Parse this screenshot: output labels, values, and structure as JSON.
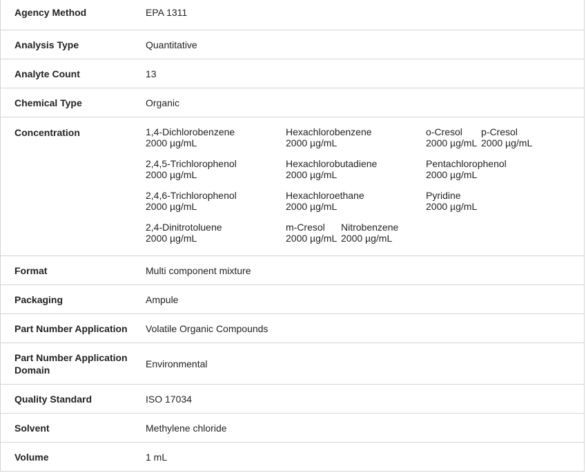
{
  "rows": [
    {
      "label": "Agency Method",
      "value": "EPA 1311"
    },
    {
      "label": "Analysis Type",
      "value": "Quantitative"
    },
    {
      "label": "Analyte Count",
      "value": "13"
    },
    {
      "label": "Chemical Type",
      "value": "Organic"
    },
    {
      "label": "Concentration",
      "value": ""
    },
    {
      "label": "Format",
      "value": "Multi component mixture"
    },
    {
      "label": "Packaging",
      "value": "Ampule"
    },
    {
      "label": "Part Number Application",
      "value": "Volatile Organic Compounds"
    },
    {
      "label": "Part Number Application Domain",
      "value": "Environmental"
    },
    {
      "label": "Quality Standard",
      "value": "ISO 17034"
    },
    {
      "label": "Solvent",
      "value": "Methylene chloride"
    },
    {
      "label": "Volume",
      "value": "1 mL"
    }
  ],
  "concentration": [
    {
      "name": "1,4-Dichlorobenzene",
      "amount": "2000 µg/mL"
    },
    {
      "name": "Hexachlorobenzene",
      "amount": "2000 µg/mL"
    },
    {
      "name": "o-Cresol",
      "amount": "2000 µg/mL"
    },
    {
      "name": "p-Cresol",
      "amount": "2000 µg/mL"
    },
    {
      "name": "2,4,5-Trichlorophenol",
      "amount": "2000 µg/mL"
    },
    {
      "name": "Hexachlorobutadiene",
      "amount": "2000 µg/mL"
    },
    {
      "name": "Pentachlorophenol",
      "amount": "2000 µg/mL"
    },
    {
      "name": "2,4,6-Trichlorophenol",
      "amount": "2000 µg/mL"
    },
    {
      "name": "Hexachloroethane",
      "amount": "2000 µg/mL"
    },
    {
      "name": "Pyridine",
      "amount": "2000 µg/mL"
    },
    {
      "name": "2,4-Dinitrotoluene",
      "amount": "2000 µg/mL"
    },
    {
      "name": "m-Cresol",
      "amount": "2000 µg/mL"
    },
    {
      "name": "Nitrobenzene",
      "amount": "2000 µg/mL"
    }
  ]
}
